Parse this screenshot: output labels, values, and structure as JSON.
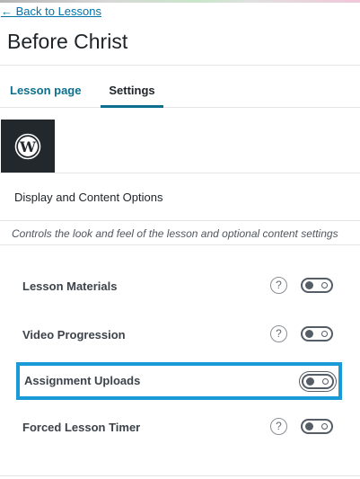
{
  "header": {
    "back_link": "← Back to Lessons",
    "title": "Before Christ"
  },
  "tabs": [
    {
      "label": "Lesson page",
      "active": false
    },
    {
      "label": "Settings",
      "active": true
    }
  ],
  "logo": "wordpress-logo",
  "section": {
    "title": "Display and Content Options",
    "description": "Controls the look and feel of the lesson and optional content settings"
  },
  "settings": [
    {
      "label": "Lesson Materials",
      "help": "?",
      "enabled": false
    },
    {
      "label": "Video Progression",
      "help": "?",
      "enabled": false
    },
    {
      "label": "Assignment Uploads",
      "enabled": false,
      "highlighted": true
    },
    {
      "label": "Forced Lesson Timer",
      "help": "?",
      "enabled": false
    }
  ],
  "colors": {
    "link": "#0073aa",
    "active_tab": "#0c6f8d",
    "highlight": "#1a9ad6",
    "logo_bg": "#23282d"
  }
}
